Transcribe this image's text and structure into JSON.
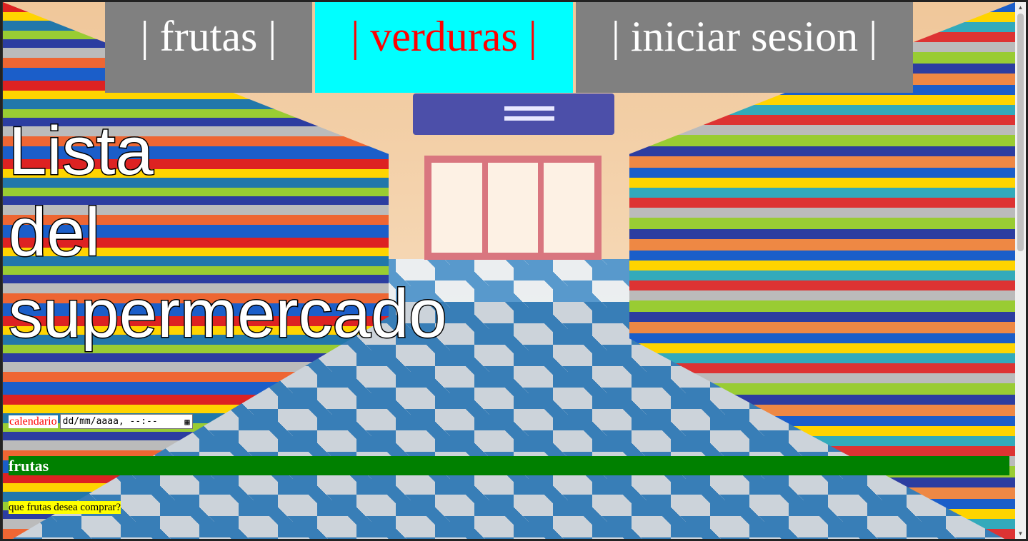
{
  "nav": {
    "items": [
      {
        "label": "| frutas |"
      },
      {
        "label": "| verduras |"
      },
      {
        "label": "| iniciar sesion |"
      }
    ],
    "colors": {
      "item_bg": "#808080",
      "item_text": "#ffffff",
      "active_bg": "#00ffff",
      "active_text": "#ff0000"
    }
  },
  "hero": {
    "title_lines": [
      "Lista",
      "del",
      "supermercado"
    ],
    "background_icon": "supermarket-aisle-image"
  },
  "calendar": {
    "label": "calendario",
    "placeholder": "dd/mm/aaaa, --:--",
    "icon": "calendar-icon"
  },
  "section": {
    "heading": "frutas",
    "bg_color": "#008000"
  },
  "question": {
    "text": "que frutas desea comprar?",
    "bg_color": "#ffff00"
  }
}
